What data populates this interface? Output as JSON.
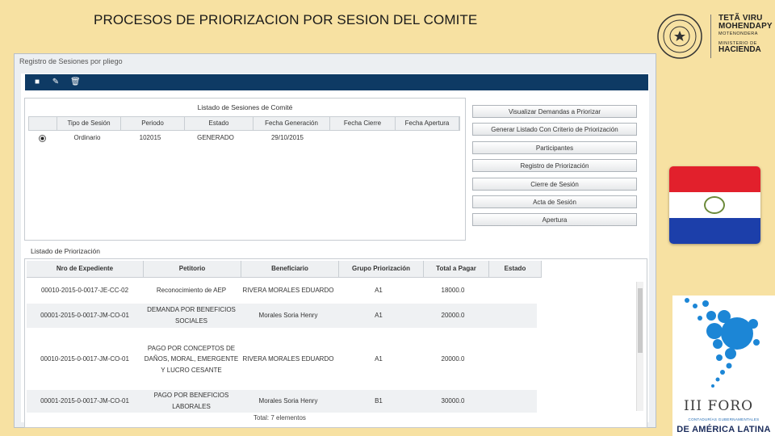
{
  "slide": {
    "title": "PROCESOS DE PRIORIZACION POR SESION DEL COMITE"
  },
  "branding": {
    "line1": "TETÃ VIRU",
    "line2": "MOHENDAPY",
    "line3": "MOTENONDERA",
    "line4": "MINISTERIO DE",
    "line5": "HACIENDA"
  },
  "window": {
    "title": "Registro de Sesiones por pliego"
  },
  "toolbar": {
    "icons": [
      "new-icon",
      "edit-icon",
      "delete-icon"
    ]
  },
  "sessions": {
    "caption": "Listado de Sesiones de Comité",
    "columns": [
      "Tipo de Sesión",
      "Periodo",
      "Estado",
      "Fecha Generación",
      "Fecha Cierre",
      "Fecha Apertura"
    ],
    "rows": [
      {
        "tipo": "Ordinario",
        "periodo": "102015",
        "estado": "GENERADO",
        "fecha_generacion": "29/10/2015",
        "fecha_cierre": "",
        "fecha_apertura": ""
      }
    ]
  },
  "actions": {
    "visualizar": "Visualizar Demandas a Priorizar",
    "generar": "Generar Listado Con Criterio de Priorización",
    "participantes": "Participantes",
    "registro": "Registro de Priorización",
    "cierre": "Cierre de Sesión",
    "acta": "Acta de Sesión",
    "apertura": "Apertura"
  },
  "priorizacion": {
    "caption": "Listado de Priorización",
    "columns": [
      "Nro de Expediente",
      "Petitorio",
      "Beneficiario",
      "Grupo Priorización",
      "Total a Pagar",
      "Estado"
    ],
    "rows": [
      {
        "expediente": "00010-2015-0-0017-JE-CC-02",
        "petitorio": "Reconocimiento de AEP",
        "beneficiario": "RIVERA MORALES EDUARDO",
        "grupo": "A1",
        "total": "18000.0",
        "estado": ""
      },
      {
        "expediente": "00001-2015-0-0017-JM-CO-01",
        "petitorio": "DEMANDA POR BENEFICIOS SOCIALES",
        "beneficiario": "Morales Soria Henry",
        "grupo": "A1",
        "total": "20000.0",
        "estado": ""
      },
      {
        "expediente": "00010-2015-0-0017-JM-CO-01",
        "petitorio": "PAGO POR CONCEPTOS DE DAÑOS, MORAL, EMERGENTE Y LUCRO CESANTE",
        "beneficiario": "RIVERA MORALES EDUARDO",
        "grupo": "A1",
        "total": "20000.0",
        "estado": ""
      },
      {
        "expediente": "00001-2015-0-0017-JM-CO-01",
        "petitorio": "PAGO POR BENEFICIOS LABORALES",
        "beneficiario": "Morales Soria Henry",
        "grupo": "B1",
        "total": "30000.0",
        "estado": ""
      }
    ],
    "footer": "Total: 7 elementos"
  },
  "foro": {
    "title": "III FORO",
    "subtitle": "CONTADURÍAS GUBERNAMENTALES",
    "region": "DE AMÉRICA LATINA"
  }
}
